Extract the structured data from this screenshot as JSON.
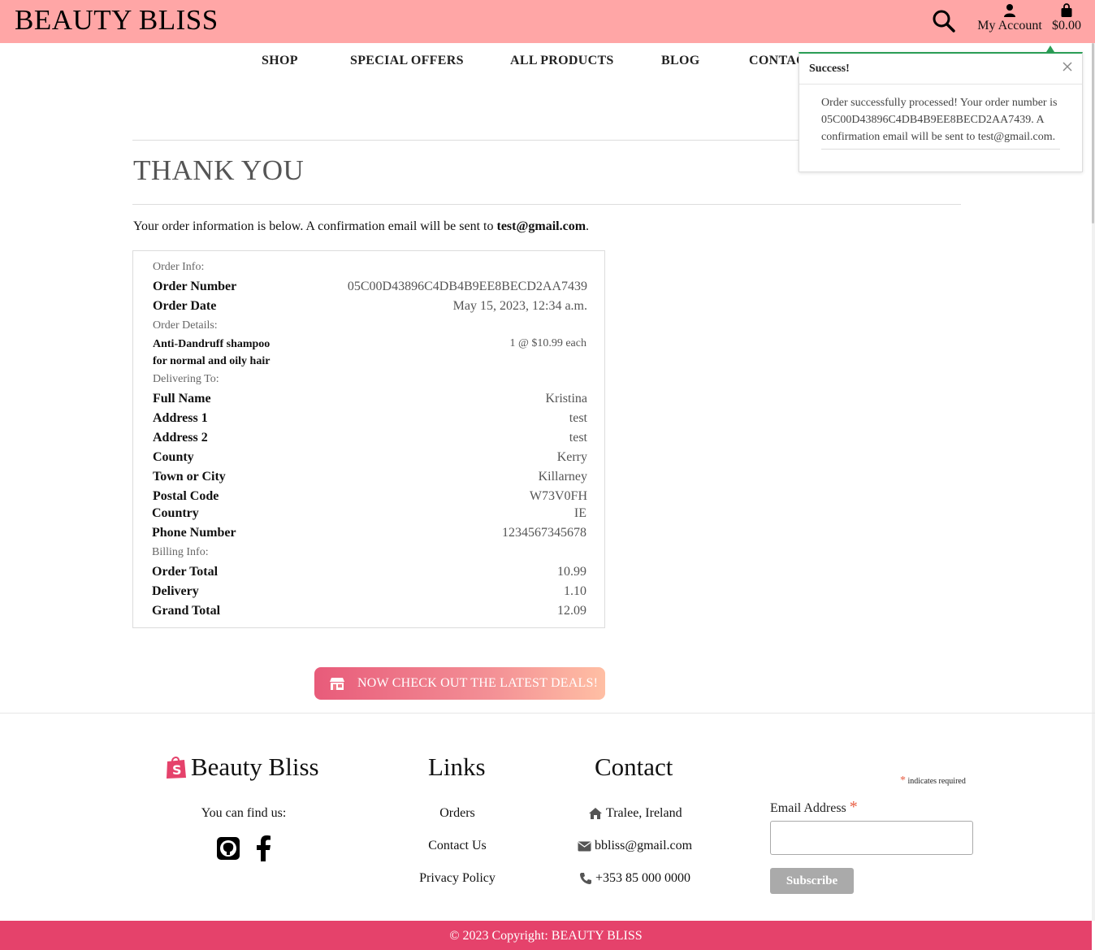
{
  "header": {
    "brand": "BEAUTY BLISS",
    "account_label": "My Account",
    "cart_total": "$0.00"
  },
  "nav": {
    "items": [
      "SHOP",
      "SPECIAL OFFERS",
      "ALL PRODUCTS",
      "BLOG",
      "CONTAC"
    ]
  },
  "page": {
    "title": "THANK YOU",
    "intro_prefix": "Your order information is below. A confirmation email will be sent to ",
    "intro_email": "test@gmail.com",
    "intro_suffix": "."
  },
  "order": {
    "section_info": "Order Info:",
    "order_number_label": "Order Number",
    "order_number": "05C00D43896C4DB4B9EE8BECD2AA7439",
    "order_date_label": "Order Date",
    "order_date": "May 15, 2023, 12:34 a.m.",
    "section_details": "Order Details:",
    "product_line1": "Anti-Dandruff shampoo",
    "product_line2": "for normal and oily hair",
    "product_qty": "1 @ $10.99 each",
    "section_delivery": "Delivering To:",
    "full_name_label": "Full Name",
    "full_name": "Kristina",
    "address1_label": "Address 1",
    "address1": "test",
    "address2_label": "Address 2",
    "address2": "test",
    "county_label": "County",
    "county": "Kerry",
    "town_label": "Town or City",
    "town": "Killarney",
    "postal_label": "Postal Code",
    "postal": "W73V0FH",
    "country_label": "Country",
    "country": "IE",
    "phone_label": "Phone Number",
    "phone": "1234567345678",
    "section_billing": "Billing Info:",
    "order_total_label": "Order Total",
    "order_total": "10.99",
    "delivery_label": "Delivery",
    "delivery": "1.10",
    "grand_total_label": "Grand Total",
    "grand_total": "12.09"
  },
  "toast": {
    "title": "Success!",
    "message": "Order successfully processed! Your order number is 05C00D43896C4DB4B9EE8BECD2AA7439. A confirmation email will be sent to test@gmail.com.",
    "accent_color": "#2a9d55"
  },
  "deals_button": "NOW CHECK OUT THE LATEST DEALS!",
  "footer": {
    "brand": "Beauty Bliss",
    "find_us": "You can find us:",
    "links_heading": "Links",
    "links": [
      "Orders",
      "Contact Us",
      "Privacy Policy"
    ],
    "contact_heading": "Contact",
    "location": "Tralee, Ireland",
    "email": "bbliss@gmail.com",
    "phone": "+353 85 000 0000",
    "required_note": "indicates required",
    "required_star": "*",
    "email_label": "Email Address",
    "subscribe_label": "Subscribe",
    "copyright": "© 2023 Copyright: BEAUTY BLISS"
  },
  "colors": {
    "header_bg": "#ffa6a6",
    "footer_bar": "#e5426b",
    "brand_pink": "#e5426b"
  }
}
